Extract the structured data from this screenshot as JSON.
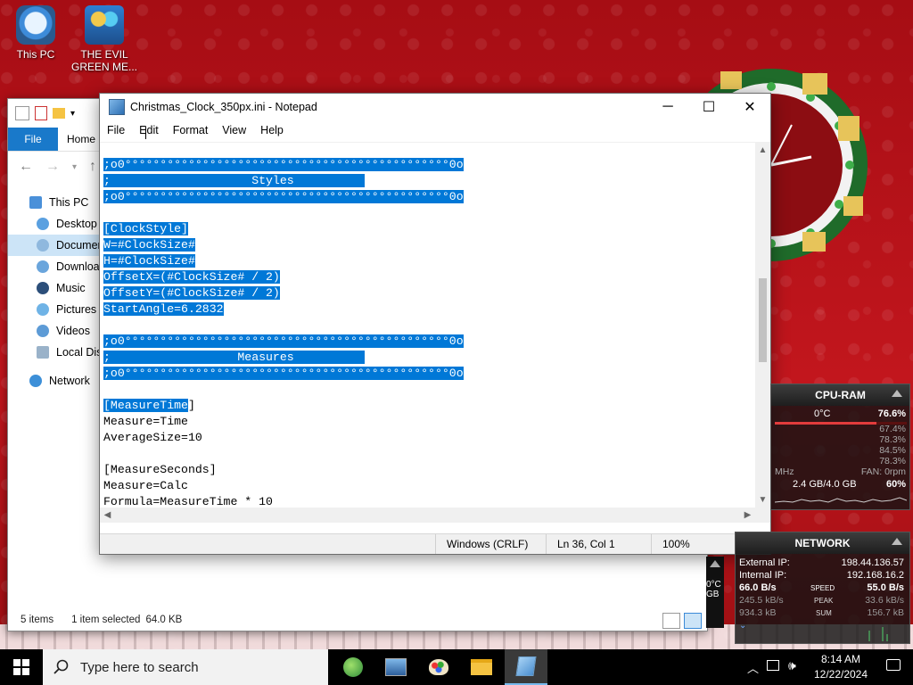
{
  "desktop": {
    "icons": [
      {
        "label": "This PC"
      },
      {
        "label": "THE EVIL GREEN ME..."
      }
    ]
  },
  "explorer": {
    "ribbon": {
      "file_tab": "File",
      "home_tab": "Home"
    },
    "nav_items": [
      {
        "label": "This PC",
        "icon": "this-pc-icon"
      },
      {
        "label": "Desktop",
        "icon": "desktop-icon"
      },
      {
        "label": "Documents",
        "icon": "documents-icon"
      },
      {
        "label": "Downloads",
        "icon": "downloads-icon"
      },
      {
        "label": "Music",
        "icon": "music-icon"
      },
      {
        "label": "Pictures",
        "icon": "pictures-icon"
      },
      {
        "label": "Videos",
        "icon": "videos-icon"
      },
      {
        "label": "Local Disk",
        "icon": "disk-icon"
      },
      {
        "label": "Network",
        "icon": "network-icon"
      }
    ],
    "status": {
      "items": "5 items",
      "selected": "1 item selected",
      "size": "64.0 KB"
    }
  },
  "notepad": {
    "title": "Christmas_Clock_350px.ini - Notepad",
    "menu": [
      "File",
      "Edit",
      "Format",
      "View",
      "Help"
    ],
    "lines": [
      {
        "text": ";o0°°°°°°°°°°°°°°°°°°°°°°°°°°°°°°°°°°°°°°°°°°°°°°0o",
        "hl": true
      },
      {
        "text": ";                    Styles          ",
        "hl": true
      },
      {
        "text": ";o0°°°°°°°°°°°°°°°°°°°°°°°°°°°°°°°°°°°°°°°°°°°°°°0o",
        "hl": true
      },
      {
        "text": "",
        "hl": false
      },
      {
        "text": "[ClockStyle]",
        "hl": true
      },
      {
        "text": "W=#ClockSize#",
        "hl": true
      },
      {
        "text": "H=#ClockSize#",
        "hl": true
      },
      {
        "text": "OffsetX=(#ClockSize# / 2)",
        "hl": true
      },
      {
        "text": "OffsetY=(#ClockSize# / 2)",
        "hl": true
      },
      {
        "text": "StartAngle=6.2832",
        "hl": true
      },
      {
        "text": "",
        "hl": false
      },
      {
        "text": ";o0°°°°°°°°°°°°°°°°°°°°°°°°°°°°°°°°°°°°°°°°°°°°°°0o",
        "hl": true
      },
      {
        "text": ";                  Measures          ",
        "hl": true
      },
      {
        "text": ";o0°°°°°°°°°°°°°°°°°°°°°°°°°°°°°°°°°°°°°°°°°°°°°°0o",
        "hl": true
      },
      {
        "text": "",
        "hl": false
      },
      {
        "text": "[MeasureTime",
        "hl": true,
        "rest": "]"
      },
      {
        "text": "Measure=Time",
        "hl": false
      },
      {
        "text": "AverageSize=10",
        "hl": false
      },
      {
        "text": "",
        "hl": false
      },
      {
        "text": "[MeasureSeconds]",
        "hl": false
      },
      {
        "text": "Measure=Calc",
        "hl": false
      },
      {
        "text": "Formula=MeasureTime * 10",
        "hl": false
      }
    ],
    "status": {
      "encoding": "Windows (CRLF)",
      "position": "Ln 36, Col 1",
      "zoom": "100%"
    }
  },
  "cpu_widget": {
    "title": "CPU-RAM",
    "temp": "0°C",
    "cpu_percent": "76.6%",
    "cores": [
      "67.4%",
      "78.3%",
      "84.5%",
      "78.3%"
    ],
    "mhz_label": "MHz",
    "fan": "FAN: 0rpm",
    "ram": "2.4 GB/4.0 GB",
    "ram_percent": "60%"
  },
  "network_widget": {
    "title": "NETWORK",
    "external_label": "External IP:",
    "external_ip": "198.44.136.57",
    "internal_label": "Internal IP:",
    "internal_ip": "192.168.16.2",
    "download": "66.0 B/s",
    "upload": "55.0 B/s",
    "speed_label": "SPEED",
    "peak_down": "245.5 kB/s",
    "peak_label": "PEAK",
    "peak_up": "33.6 kB/s",
    "sum_down": "934.3 kB",
    "sum_label": "SUM",
    "sum_up": "156.7 kB"
  },
  "partial_widget": {
    "temp": "0°C",
    "unit": "GB"
  },
  "taskbar": {
    "search_placeholder": "Type here to search",
    "time": "8:14 AM",
    "date": "12/22/2024"
  }
}
